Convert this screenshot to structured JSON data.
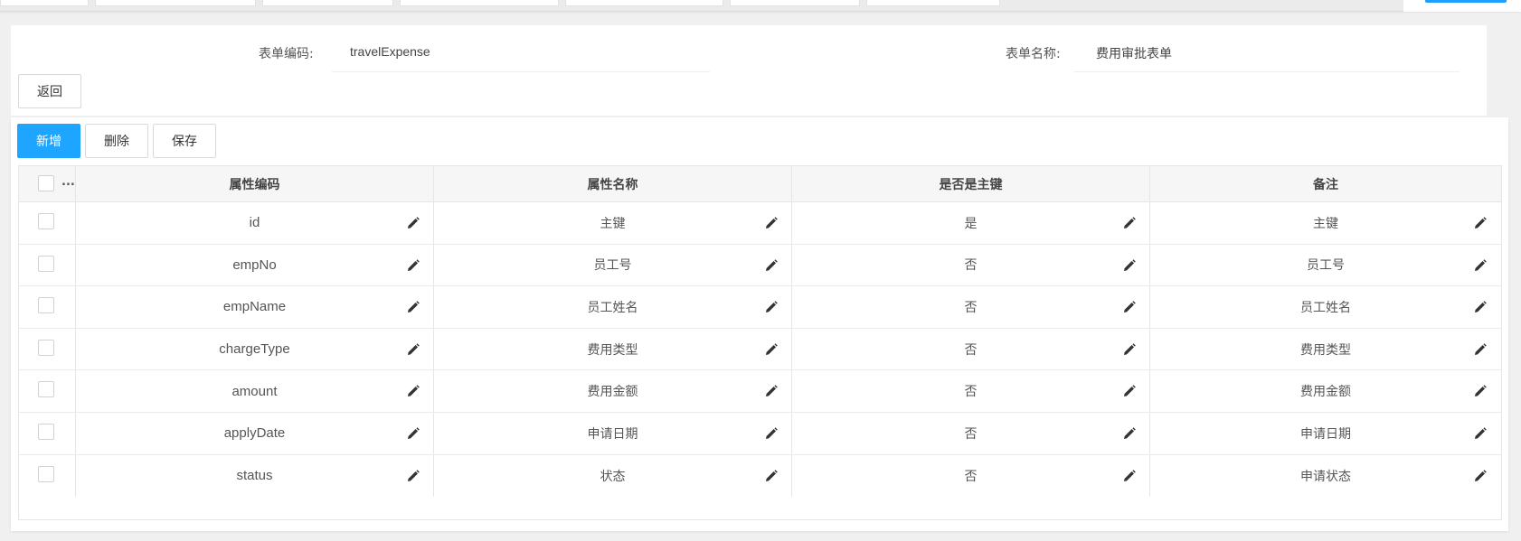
{
  "form": {
    "code_label": "表单编码:",
    "code_value": "travelExpense",
    "name_label": "表单名称:",
    "name_value": "费用审批表单",
    "back_button": "返回"
  },
  "toolbar": {
    "add_button": "新增",
    "delete_button": "删除",
    "save_button": "保存"
  },
  "table": {
    "select_all_more": "...",
    "columns": [
      "属性编码",
      "属性名称",
      "是否是主键",
      "备注"
    ],
    "rows": [
      {
        "code": "id",
        "name": "主键",
        "is_pk": "是",
        "remark": "主键"
      },
      {
        "code": "empNo",
        "name": "员工号",
        "is_pk": "否",
        "remark": "员工号"
      },
      {
        "code": "empName",
        "name": "员工姓名",
        "is_pk": "否",
        "remark": "员工姓名"
      },
      {
        "code": "chargeType",
        "name": "费用类型",
        "is_pk": "否",
        "remark": "费用类型"
      },
      {
        "code": "amount",
        "name": "费用金额",
        "is_pk": "否",
        "remark": "费用金额"
      },
      {
        "code": "applyDate",
        "name": "申请日期",
        "is_pk": "否",
        "remark": "申请日期"
      },
      {
        "code": "status",
        "name": "状态",
        "is_pk": "否",
        "remark": "申请状态"
      }
    ]
  },
  "colors": {
    "primary": "#1ea5ff",
    "page_bg": "#f0f0f0",
    "border": "#e6e6e6"
  },
  "icons": {
    "edit": "pencil-icon",
    "checkbox": "checkbox-icon"
  }
}
